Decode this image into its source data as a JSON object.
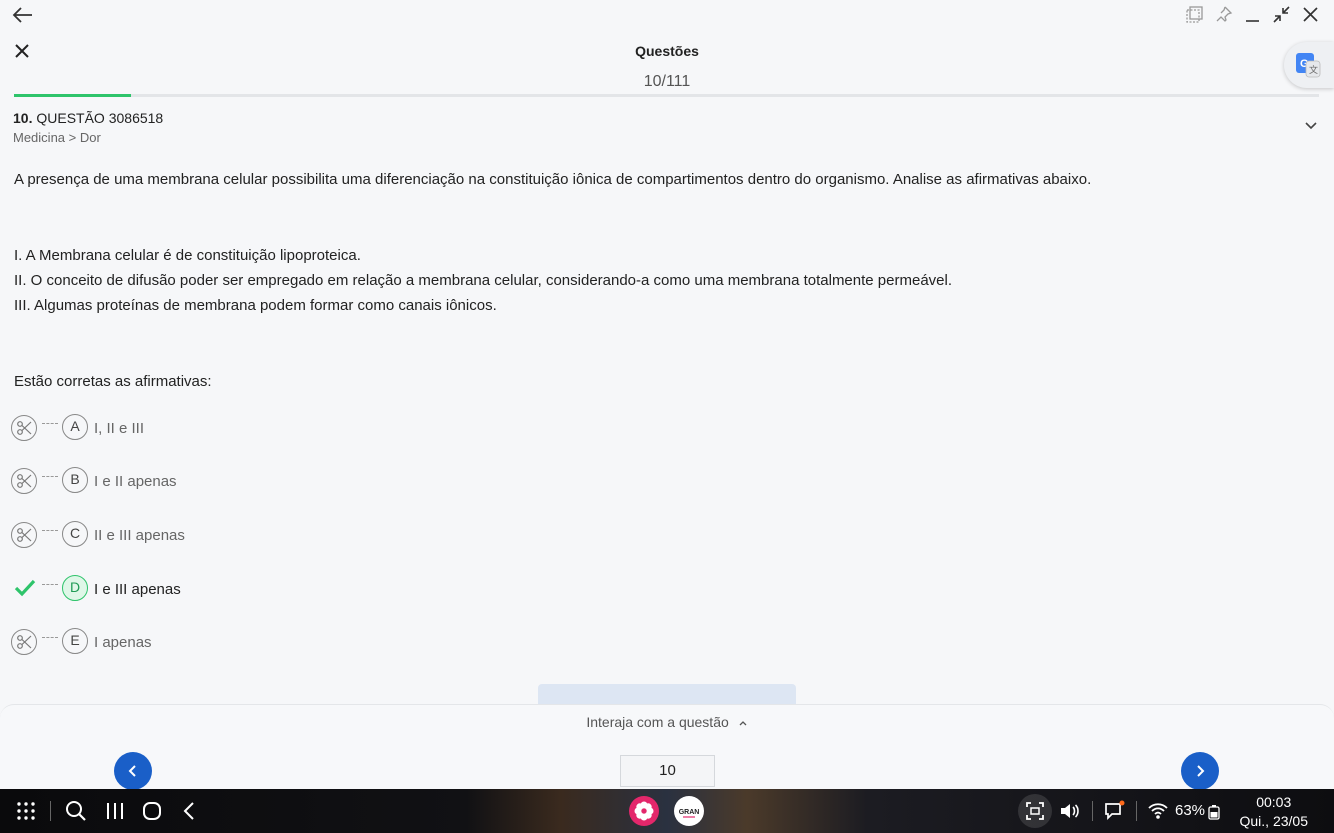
{
  "header": {
    "title": "Questões",
    "counter": "10/111",
    "progress": 0.09
  },
  "question": {
    "number": "10.",
    "label": "QUESTÃO 3086518",
    "breadcrumb": "Medicina > Dor",
    "statement": "A presença de uma membrana celular possibilita uma diferenciação na constituição iônica de compartimentos dentro do organismo. Analise as afirmativas abaixo.",
    "items": [
      "I. A Membrana celular é de constituição lipoproteica.",
      "II. O conceito de difusão poder ser empregado em relação a membrana celular, considerando-a como uma membrana totalmente permeável.",
      "III. Algumas proteínas de membrana podem formar como canais iônicos."
    ],
    "prompt": "Estão corretas as afirmativas:"
  },
  "options": [
    {
      "letter": "A",
      "text": "I, II e III",
      "correct": false
    },
    {
      "letter": "B",
      "text": "I e II apenas",
      "correct": false
    },
    {
      "letter": "C",
      "text": "II e III apenas",
      "correct": false
    },
    {
      "letter": "D",
      "text": "I e III apenas",
      "correct": true
    },
    {
      "letter": "E",
      "text": "I apenas",
      "correct": false
    }
  ],
  "interact": {
    "label": "Interaja com a questão",
    "page": "10"
  },
  "taskbar": {
    "battery": "63%",
    "time": "00:03",
    "date": "Qui., 23/05",
    "gran_label": "GRAN"
  },
  "colors": {
    "accent_green": "#2ec46b",
    "nav_blue": "#1a5fc8"
  }
}
